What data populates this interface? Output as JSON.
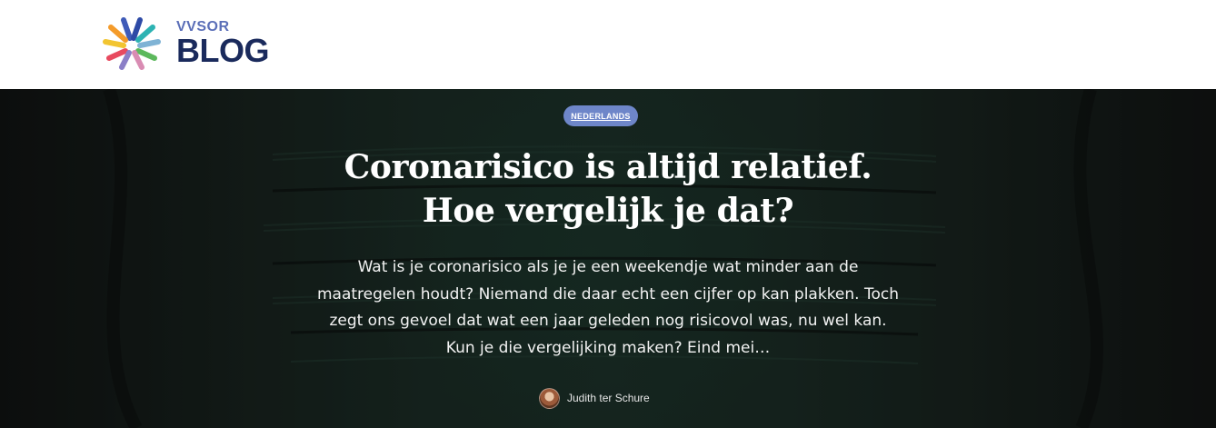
{
  "header": {
    "logo_small": "VVSOR",
    "logo_big": "BLOG",
    "logo_text_small_color": "#5b6fb8",
    "logo_text_big_color": "#1a2a5c",
    "logo_ray_colors": [
      "#3f5bb8",
      "#e84a5f",
      "#f49b2a",
      "#f2c531",
      "#5cb85c",
      "#2db3b3",
      "#7fb3d5",
      "#8b7fc7"
    ]
  },
  "hero": {
    "tag": "NEDERLANDS",
    "tag_color": "#6e86c9",
    "title_line1": "Coronarisico is altijd relatief.",
    "title_line2": "Hoe vergelijk je dat?",
    "excerpt": "Wat is je coronarisico als je je een weekendje wat minder aan de maatregelen houdt? Niemand die daar echt een cijfer op kan plakken. Toch zegt ons gevoel dat wat een jaar geleden nog risicovol was, nu wel kan. Kun je die vergelijking maken? Eind mei…",
    "author": "Judith ter Schure",
    "background_description_icon": "face-mask-photo"
  }
}
